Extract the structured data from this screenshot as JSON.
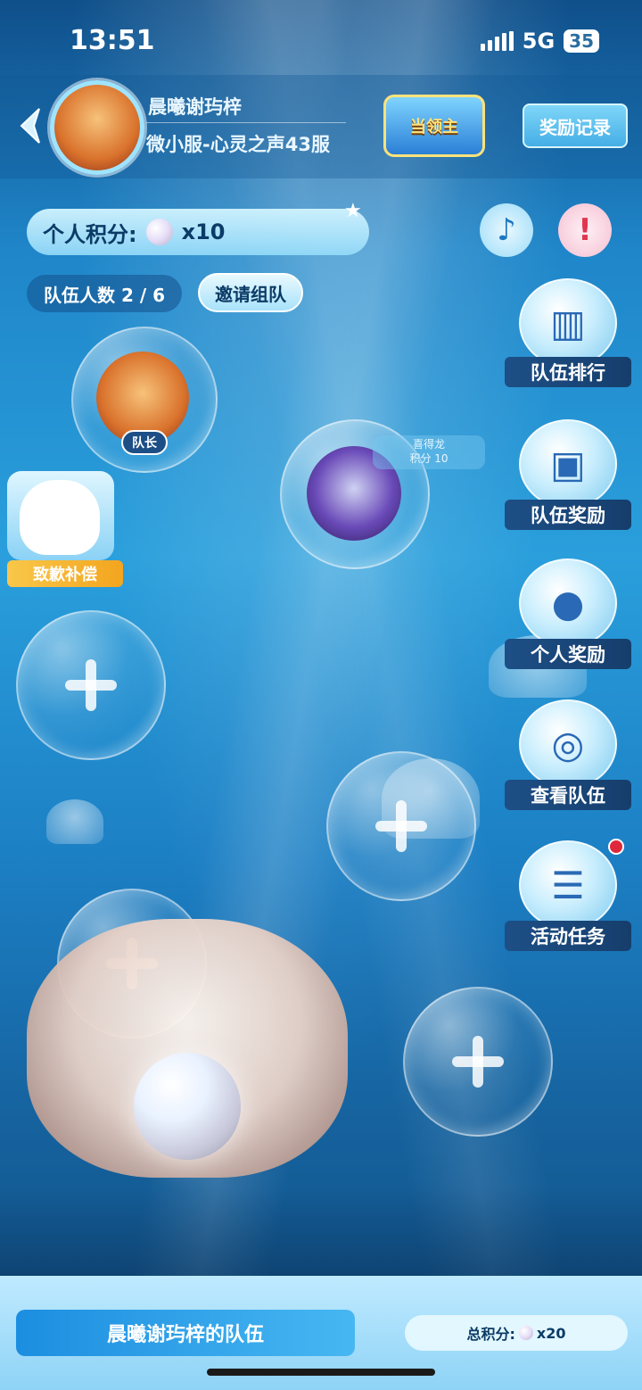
{
  "status": {
    "time": "13:51",
    "network": "5G",
    "battery": "35"
  },
  "header": {
    "player_name": "晨曦谢玙梓",
    "server": "微小服-心灵之声43服",
    "logo_text": "当领主",
    "reward_record": "奖励记录"
  },
  "score": {
    "label": "个人积分:",
    "value": "x10"
  },
  "team": {
    "count": "队伍人数 2 / 6",
    "invite": "邀请组队"
  },
  "members": [
    {
      "badge": "队长"
    },
    {
      "name": "喜得龙",
      "score": "积分 10"
    }
  ],
  "compensation": {
    "label": "致歉补偿"
  },
  "side_menu": [
    {
      "label": "队伍排行",
      "icon": "ranking-podium-icon"
    },
    {
      "label": "队伍奖励",
      "icon": "treasure-chest-icon"
    },
    {
      "label": "个人奖励",
      "icon": "pearl-hand-icon"
    },
    {
      "label": "查看队伍",
      "icon": "team-group-icon"
    },
    {
      "label": "活动任务",
      "icon": "task-clipboard-icon"
    }
  ],
  "footer": {
    "team_name": "晨曦谢玙梓的队伍",
    "total_label": "总积分:",
    "total_value": "x20"
  },
  "colors": {
    "accent": "#1d4f86",
    "alert": "#e0283c",
    "gold": "#f3a51e"
  }
}
